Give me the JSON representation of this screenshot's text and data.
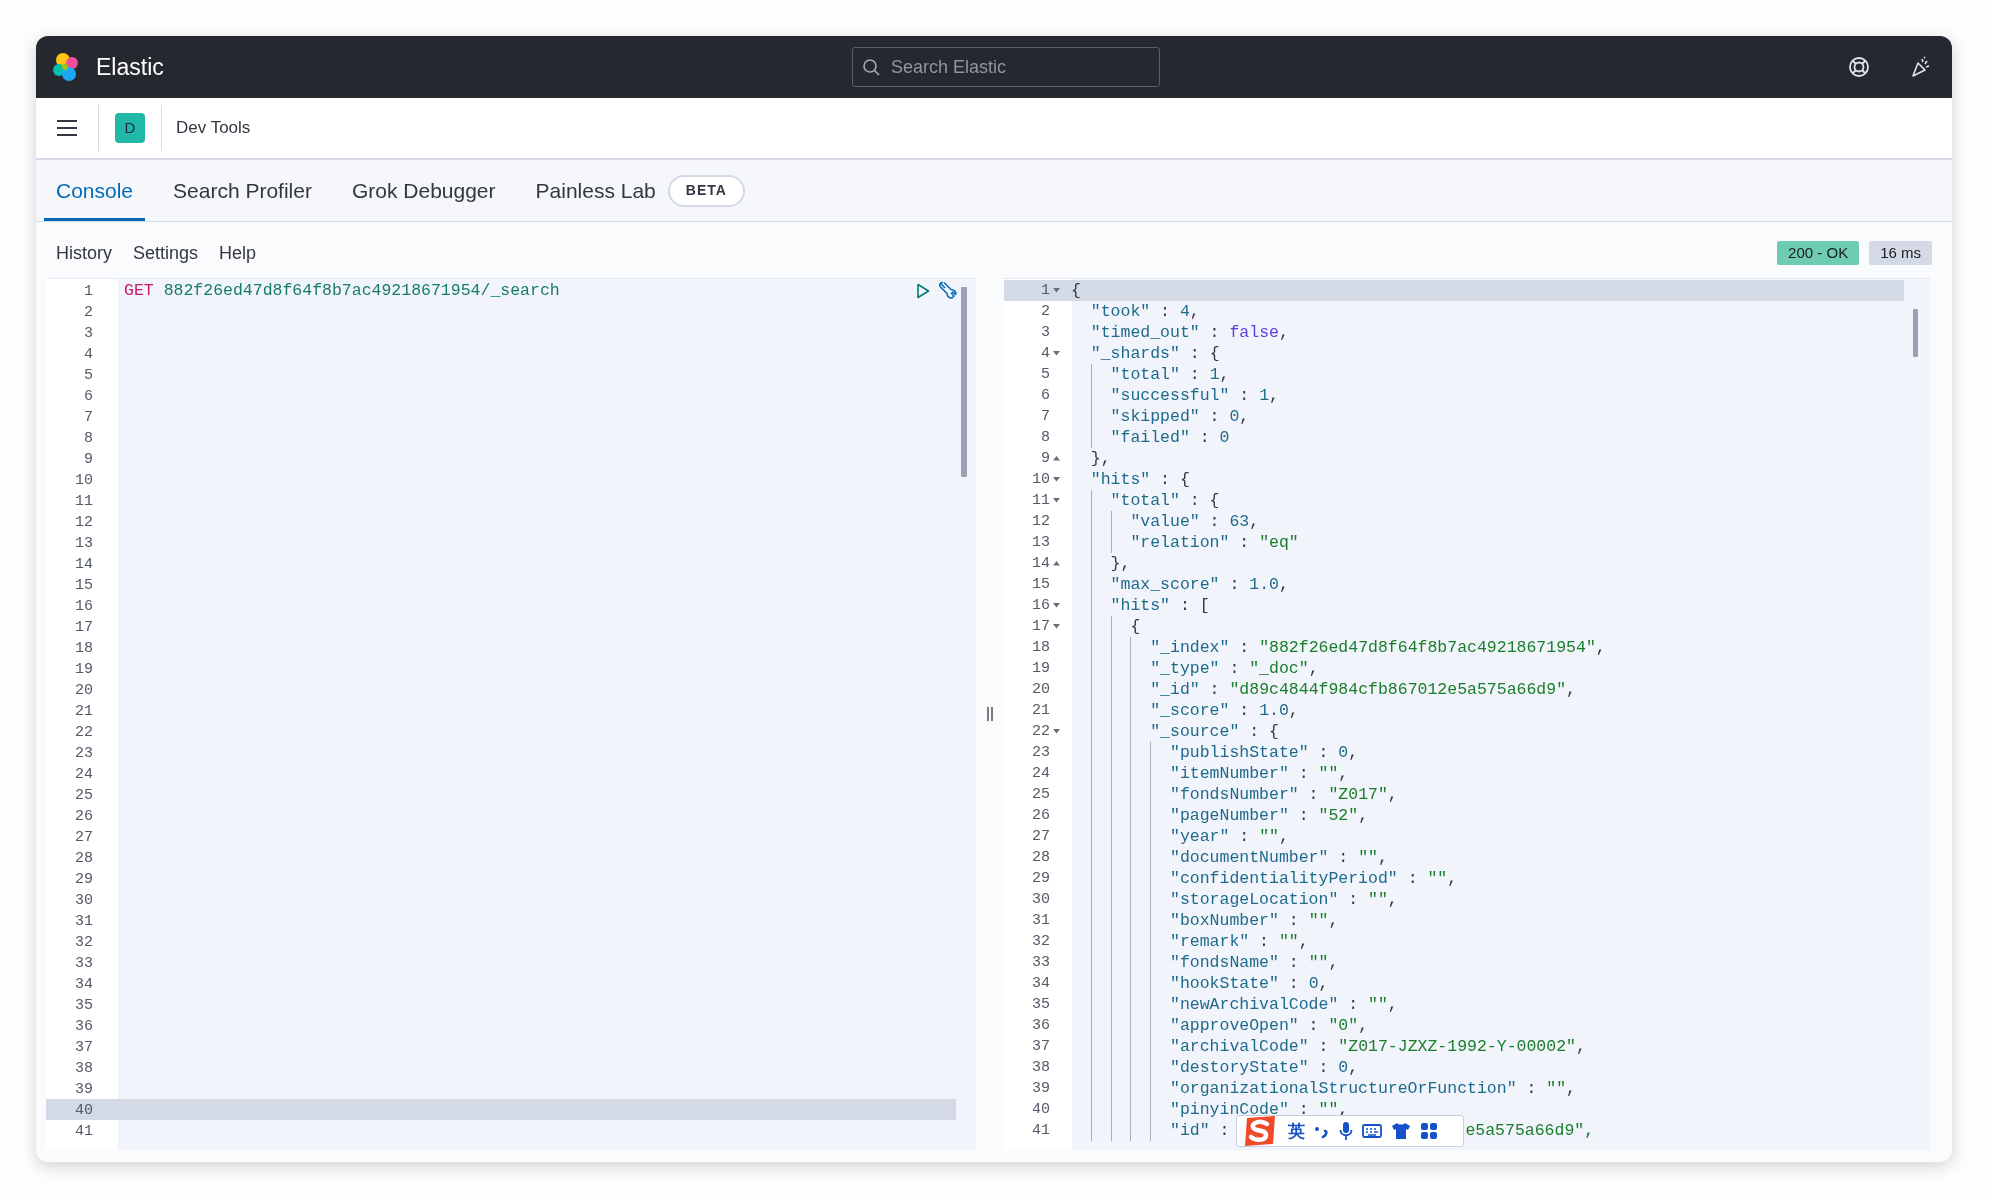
{
  "header": {
    "brand": "Elastic",
    "search": {
      "placeholder": "Search Elastic"
    }
  },
  "breadcrumb": {
    "avatar": "D",
    "title": "Dev Tools"
  },
  "tabs": [
    {
      "label": "Console",
      "selected": true
    },
    {
      "label": "Search Profiler",
      "selected": false
    },
    {
      "label": "Grok Debugger",
      "selected": false
    },
    {
      "label": "Painless Lab",
      "selected": false,
      "badge": "BETA"
    }
  ],
  "toolbar": {
    "links": [
      "History",
      "Settings",
      "Help"
    ],
    "status": "200 - OK",
    "time": "16 ms"
  },
  "request_editor": {
    "lines": [
      {
        "n": "1",
        "method": "GET",
        "path": "882f26ed47d8f64f8b7ac49218671954/_search",
        "active": false
      },
      {
        "n": "2",
        "active": false
      },
      {
        "n": "3",
        "active": false
      },
      {
        "n": "4",
        "active": false
      },
      {
        "n": "5",
        "active": false
      },
      {
        "n": "6",
        "active": false
      },
      {
        "n": "7",
        "active": false
      },
      {
        "n": "8",
        "active": false
      },
      {
        "n": "9",
        "active": false
      },
      {
        "n": "10",
        "active": false
      },
      {
        "n": "11",
        "active": false
      },
      {
        "n": "12",
        "active": false
      },
      {
        "n": "13",
        "active": false
      },
      {
        "n": "14",
        "active": false
      },
      {
        "n": "15",
        "active": false
      },
      {
        "n": "16",
        "active": false
      },
      {
        "n": "17",
        "active": false
      },
      {
        "n": "18",
        "active": false
      },
      {
        "n": "19",
        "active": false
      },
      {
        "n": "20",
        "active": false
      },
      {
        "n": "21",
        "active": false
      },
      {
        "n": "22",
        "active": false
      },
      {
        "n": "23",
        "active": false
      },
      {
        "n": "24",
        "active": false
      },
      {
        "n": "25",
        "active": false
      },
      {
        "n": "26",
        "active": false
      },
      {
        "n": "27",
        "active": false
      },
      {
        "n": "28",
        "active": false
      },
      {
        "n": "29",
        "active": false
      },
      {
        "n": "30",
        "active": false
      },
      {
        "n": "31",
        "active": false
      },
      {
        "n": "32",
        "active": false
      },
      {
        "n": "33",
        "active": false
      },
      {
        "n": "34",
        "active": false
      },
      {
        "n": "35",
        "active": false
      },
      {
        "n": "36",
        "active": false
      },
      {
        "n": "37",
        "active": false
      },
      {
        "n": "38",
        "active": false
      },
      {
        "n": "39",
        "active": false
      },
      {
        "n": "40",
        "active": true
      },
      {
        "n": "41",
        "active": false
      }
    ]
  },
  "response_editor": {
    "lines": [
      {
        "n": "1",
        "text": "{",
        "kind": "fold-start",
        "active": true
      },
      {
        "n": "2",
        "text": "  \"took\" : 4,",
        "kind": "plain",
        "active": false
      },
      {
        "n": "3",
        "text": "  \"timed_out\" : false,",
        "kind": "plain",
        "active": false
      },
      {
        "n": "4",
        "text": "  \"_shards\" : {",
        "kind": "fold-start",
        "active": false
      },
      {
        "n": "5",
        "text": "    \"total\" : 1,",
        "kind": "plain",
        "active": false
      },
      {
        "n": "6",
        "text": "    \"successful\" : 1,",
        "kind": "plain",
        "active": false
      },
      {
        "n": "7",
        "text": "    \"skipped\" : 0,",
        "kind": "plain",
        "active": false
      },
      {
        "n": "8",
        "text": "    \"failed\" : 0",
        "kind": "plain",
        "active": false
      },
      {
        "n": "9",
        "text": "  },",
        "kind": "fold-end",
        "active": false
      },
      {
        "n": "10",
        "text": "  \"hits\" : {",
        "kind": "fold-start",
        "active": false
      },
      {
        "n": "11",
        "text": "    \"total\" : {",
        "kind": "fold-start",
        "active": false
      },
      {
        "n": "12",
        "text": "      \"value\" : 63,",
        "kind": "plain",
        "active": false
      },
      {
        "n": "13",
        "text": "      \"relation\" : \"eq\"",
        "kind": "plain",
        "active": false
      },
      {
        "n": "14",
        "text": "    },",
        "kind": "fold-end",
        "active": false
      },
      {
        "n": "15",
        "text": "    \"max_score\" : 1.0,",
        "kind": "plain",
        "active": false
      },
      {
        "n": "16",
        "text": "    \"hits\" : [",
        "kind": "fold-start",
        "active": false
      },
      {
        "n": "17",
        "text": "      {",
        "kind": "fold-start",
        "active": false
      },
      {
        "n": "18",
        "text": "        \"_index\" : \"882f26ed47d8f64f8b7ac49218671954\",",
        "kind": "plain",
        "active": false
      },
      {
        "n": "19",
        "text": "        \"_type\" : \"_doc\",",
        "kind": "plain",
        "active": false
      },
      {
        "n": "20",
        "text": "        \"_id\" : \"d89c4844f984cfb867012e5a575a66d9\",",
        "kind": "plain",
        "active": false
      },
      {
        "n": "21",
        "text": "        \"_score\" : 1.0,",
        "kind": "plain",
        "active": false
      },
      {
        "n": "22",
        "text": "        \"_source\" : {",
        "kind": "fold-start",
        "active": false
      },
      {
        "n": "23",
        "text": "          \"publishState\" : 0,",
        "kind": "plain",
        "active": false
      },
      {
        "n": "24",
        "text": "          \"itemNumber\" : \"\",",
        "kind": "plain",
        "active": false
      },
      {
        "n": "25",
        "text": "          \"fondsNumber\" : \"Z017\",",
        "kind": "plain",
        "active": false
      },
      {
        "n": "26",
        "text": "          \"pageNumber\" : \"52\",",
        "kind": "plain",
        "active": false
      },
      {
        "n": "27",
        "text": "          \"year\" : \"\",",
        "kind": "plain",
        "active": false
      },
      {
        "n": "28",
        "text": "          \"documentNumber\" : \"\",",
        "kind": "plain",
        "active": false
      },
      {
        "n": "29",
        "text": "          \"confidentialityPeriod\" : \"\",",
        "kind": "plain",
        "active": false
      },
      {
        "n": "30",
        "text": "          \"storageLocation\" : \"\",",
        "kind": "plain",
        "active": false
      },
      {
        "n": "31",
        "text": "          \"boxNumber\" : \"\",",
        "kind": "plain",
        "active": false
      },
      {
        "n": "32",
        "text": "          \"remark\" : \"\",",
        "kind": "plain",
        "active": false
      },
      {
        "n": "33",
        "text": "          \"fondsName\" : \"\",",
        "kind": "plain",
        "active": false
      },
      {
        "n": "34",
        "text": "          \"hookState\" : 0,",
        "kind": "plain",
        "active": false
      },
      {
        "n": "35",
        "text": "          \"newArchivalCode\" : \"\",",
        "kind": "plain",
        "active": false
      },
      {
        "n": "36",
        "text": "          \"approveOpen\" : \"0\",",
        "kind": "plain",
        "active": false
      },
      {
        "n": "37",
        "text": "          \"archivalCode\" : \"Z017-JZXZ-1992-Y-00002\",",
        "kind": "plain",
        "active": false
      },
      {
        "n": "38",
        "text": "          \"destoryState\" : 0,",
        "kind": "plain",
        "active": false
      },
      {
        "n": "39",
        "text": "          \"organizationalStructureOrFunction\" : \"\",",
        "kind": "plain",
        "active": false
      },
      {
        "n": "40",
        "text": "          \"pinyinCode\" : \"\",",
        "kind": "plain",
        "active": false
      },
      {
        "n": "41",
        "text": "          \"id\" :",
        "after": "e5a575a66d9\",",
        "kind": "plain",
        "active": false
      }
    ]
  },
  "ime_toolbar": {
    "mode": "英"
  }
}
